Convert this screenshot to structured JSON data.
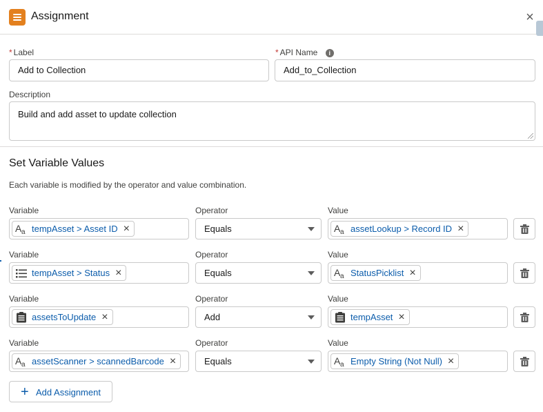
{
  "header": {
    "title": "Assignment",
    "icon": "assignment-icon",
    "close": "×"
  },
  "label": {
    "caption": "Label",
    "required": "*",
    "value": "Add to Collection"
  },
  "api_name": {
    "caption": "API Name",
    "required": "*",
    "value": "Add_to_Collection",
    "info": "i"
  },
  "description": {
    "caption": "Description",
    "value": "Build and add asset to update collection"
  },
  "section": {
    "title": "Set Variable Values",
    "desc": "Each variable is modified by the operator and value combination."
  },
  "columns": {
    "variable": "Variable",
    "operator": "Operator",
    "value": "Value"
  },
  "rows": [
    {
      "variable": "tempAsset > Asset ID",
      "variable_icon": "text-icon",
      "operator": "Equals",
      "value": "assetLookup > Record ID",
      "value_icon": "text-icon"
    },
    {
      "variable": "tempAsset > Status",
      "variable_icon": "picklist-icon",
      "operator": "Equals",
      "value": "StatusPicklist",
      "value_icon": "text-icon"
    },
    {
      "variable": "assetsToUpdate",
      "variable_icon": "collection-icon",
      "operator": "Add",
      "value": "tempAsset",
      "value_icon": "collection-icon"
    },
    {
      "variable": "assetScanner > scannedBarcode",
      "variable_icon": "text-icon",
      "operator": "Equals",
      "value": "Empty String (Not Null)",
      "value_icon": "text-icon"
    }
  ],
  "add_button": {
    "label": "Add Assignment",
    "plus": "+"
  },
  "colors": {
    "accent": "#e3801e",
    "link": "#0b5cab",
    "border": "#c9c9c9"
  }
}
